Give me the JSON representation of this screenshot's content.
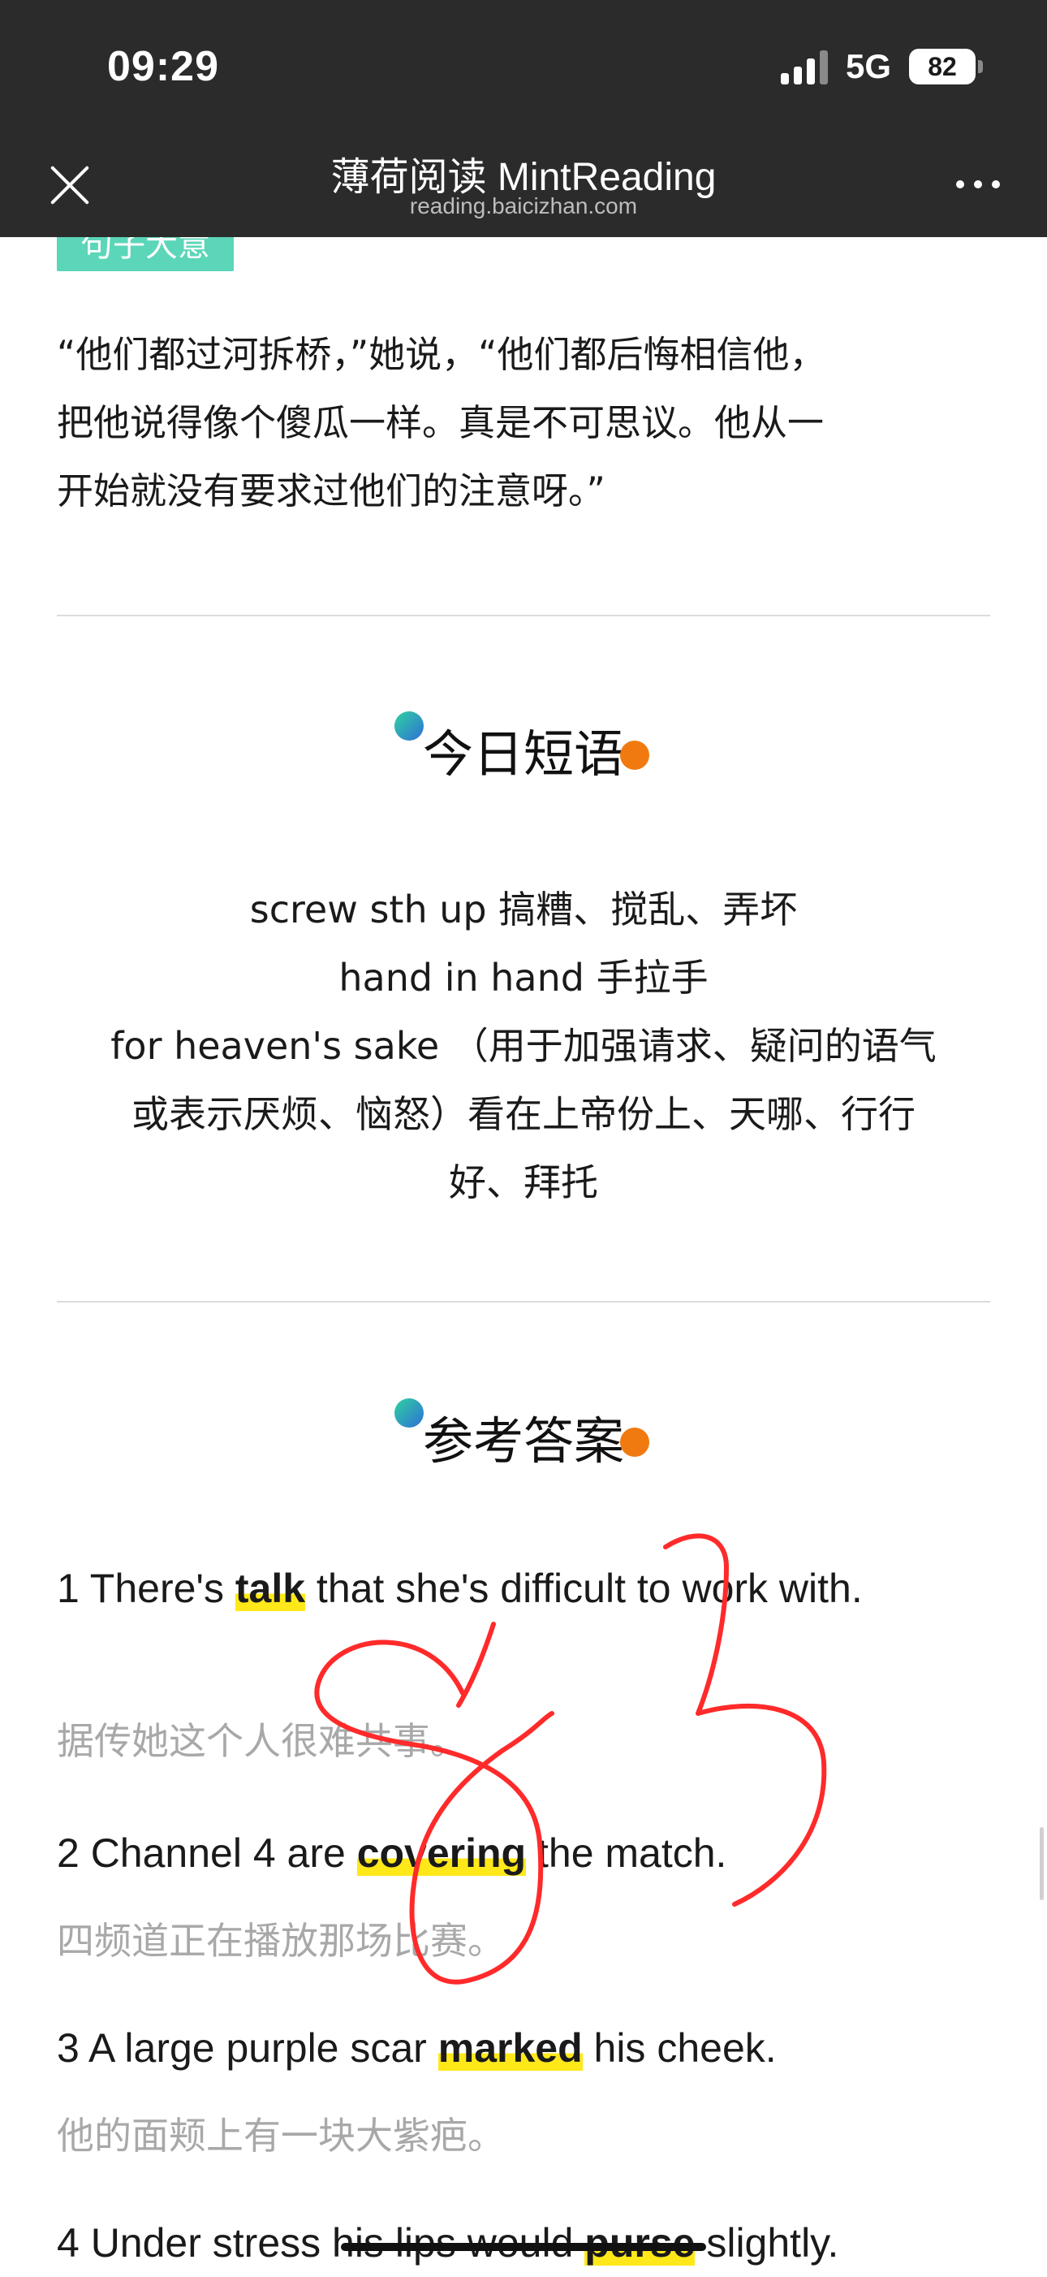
{
  "status_bar": {
    "time": "09:29",
    "network": "5G",
    "battery": "82"
  },
  "nav": {
    "title": "薄荷阅读 MintReading",
    "subtitle": "reading.baicizhan.com",
    "close_icon": "close-icon",
    "more_icon": "more-icon"
  },
  "article": {
    "peek_tag": "句子大意",
    "quote_lines": [
      "“他们都过河拆桥，”她说，“他们都后悔相信他，",
      "把他说得像个傻瓜一样。真是不可思议。他从一",
      "开始就没有要求过他们的注意呀。”"
    ]
  },
  "phrases_section": {
    "title": "今日短语",
    "lines": [
      "screw sth up 搞糟、搅乱、弄坏",
      "hand in hand 手拉手",
      "for heaven's sake （用于加强请求、疑问的语气",
      "或表示厌烦、恼怒）看在上帝份上、天哪、行行",
      "好、拜托"
    ]
  },
  "answers_section": {
    "title": "参考答案",
    "items": [
      {
        "before": "1 There's ",
        "key": "talk",
        "after": " that she's difficult to work with.",
        "translation": "据传她这个人很难共事。"
      },
      {
        "before": "2 Channel 4 are ",
        "key": "covering",
        "after": " the match.",
        "translation": "四频道正在播放那场比赛。"
      },
      {
        "before": "3 A large purple scar ",
        "key": "marked",
        "after": " his cheek.",
        "translation": "他的面颊上有一块大紫疤。"
      },
      {
        "before": "4 Under stress his lips would ",
        "key": "purse",
        "after": " slightly.",
        "translation": ""
      }
    ]
  },
  "colors": {
    "chrome": "#2b2b2b",
    "highlight": "#ffe81a",
    "tag": "#5bd6b8",
    "ink": "#ff2a2a",
    "dot_orange": "#f07a10"
  }
}
